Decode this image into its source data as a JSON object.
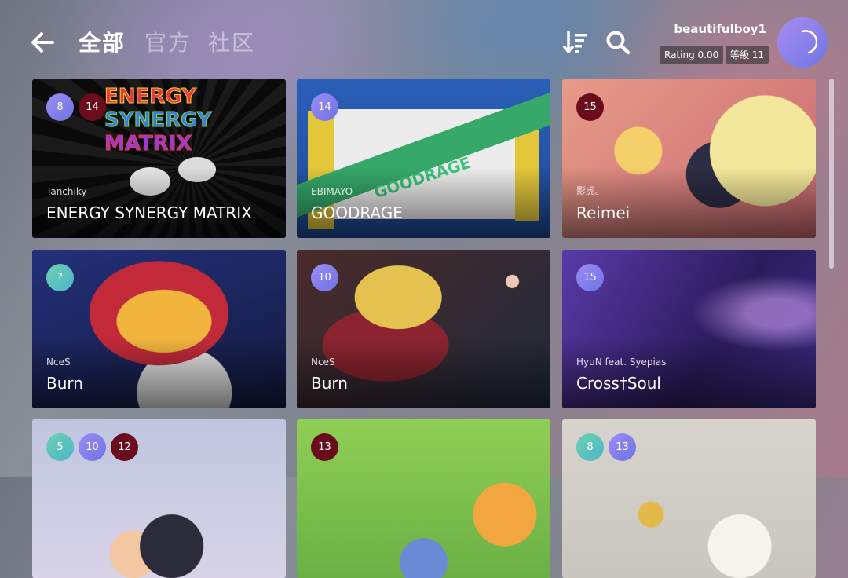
{
  "header": {
    "tabs": [
      {
        "label": "全部",
        "active": true
      },
      {
        "label": "官方",
        "active": false
      },
      {
        "label": "社区",
        "active": false
      }
    ],
    "icons": {
      "back": "arrow-left-icon",
      "sort": "sort-descending-icon",
      "search": "search-icon"
    }
  },
  "user": {
    "username": "beautifulboy1",
    "rating": "Rating 0.00",
    "level": "等級 11"
  },
  "colors": {
    "badge_red": "#6a0c1c",
    "badge_purple": "#7f7fec",
    "badge_teal": "#5cc2bf"
  },
  "cards": [
    {
      "artist": "Tanchiky",
      "title": "ENERGY SYNERGY MATRIX",
      "badges": [
        {
          "v": "8",
          "c": "purple"
        },
        {
          "v": "14",
          "c": "red"
        }
      ]
    },
    {
      "artist": "EBIMAYO",
      "title": "GOODRAGE",
      "badges": [
        {
          "v": "14",
          "c": "purple"
        }
      ]
    },
    {
      "artist": "影虎。",
      "title": "Reimei",
      "badges": [
        {
          "v": "15",
          "c": "red"
        }
      ]
    },
    {
      "artist": "NceS",
      "title": "Burn",
      "badges": [
        {
          "v": "?",
          "c": "teal"
        }
      ]
    },
    {
      "artist": "NceS",
      "title": "Burn",
      "badges": [
        {
          "v": "10",
          "c": "purple"
        }
      ]
    },
    {
      "artist": "HyuN feat. Syepias",
      "title": "Cross†Soul",
      "badges": [
        {
          "v": "15",
          "c": "purple"
        }
      ]
    },
    {
      "artist": "",
      "title": "",
      "badges": [
        {
          "v": "5",
          "c": "teal"
        },
        {
          "v": "10",
          "c": "purple"
        },
        {
          "v": "12",
          "c": "red"
        }
      ]
    },
    {
      "artist": "",
      "title": "",
      "badges": [
        {
          "v": "13",
          "c": "red"
        }
      ]
    },
    {
      "artist": "",
      "title": "",
      "badges": [
        {
          "v": "8",
          "c": "teal"
        },
        {
          "v": "13",
          "c": "purple"
        }
      ]
    }
  ]
}
